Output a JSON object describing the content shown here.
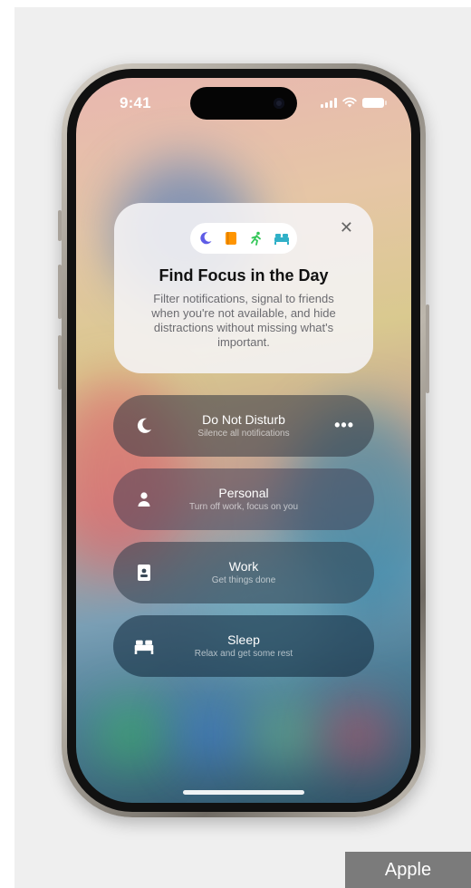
{
  "status_bar": {
    "time": "9:41"
  },
  "focus_card": {
    "icons": [
      "moon-icon",
      "book-icon",
      "running-person-icon",
      "bed-icon"
    ],
    "title": "Find Focus in the Day",
    "description": "Filter notifications, signal to friends when you're not available, and hide distractions without missing what's important.",
    "close_icon": "close-icon"
  },
  "focus_modes": [
    {
      "name": "Do Not Disturb",
      "subtitle": "Silence all notifications",
      "icon": "moon-icon",
      "more": "•••"
    },
    {
      "name": "Personal",
      "subtitle": "Turn off work, focus on you",
      "icon": "person-icon"
    },
    {
      "name": "Work",
      "subtitle": "Get things done",
      "icon": "id-badge-icon"
    },
    {
      "name": "Sleep",
      "subtitle": "Relax and get some rest",
      "icon": "bed-icon"
    }
  ],
  "credit": "Apple",
  "colors": {
    "moon": "#5e5ce6",
    "book": "#ff9500",
    "fitness": "#34c759",
    "sleep": "#30b0c7"
  }
}
